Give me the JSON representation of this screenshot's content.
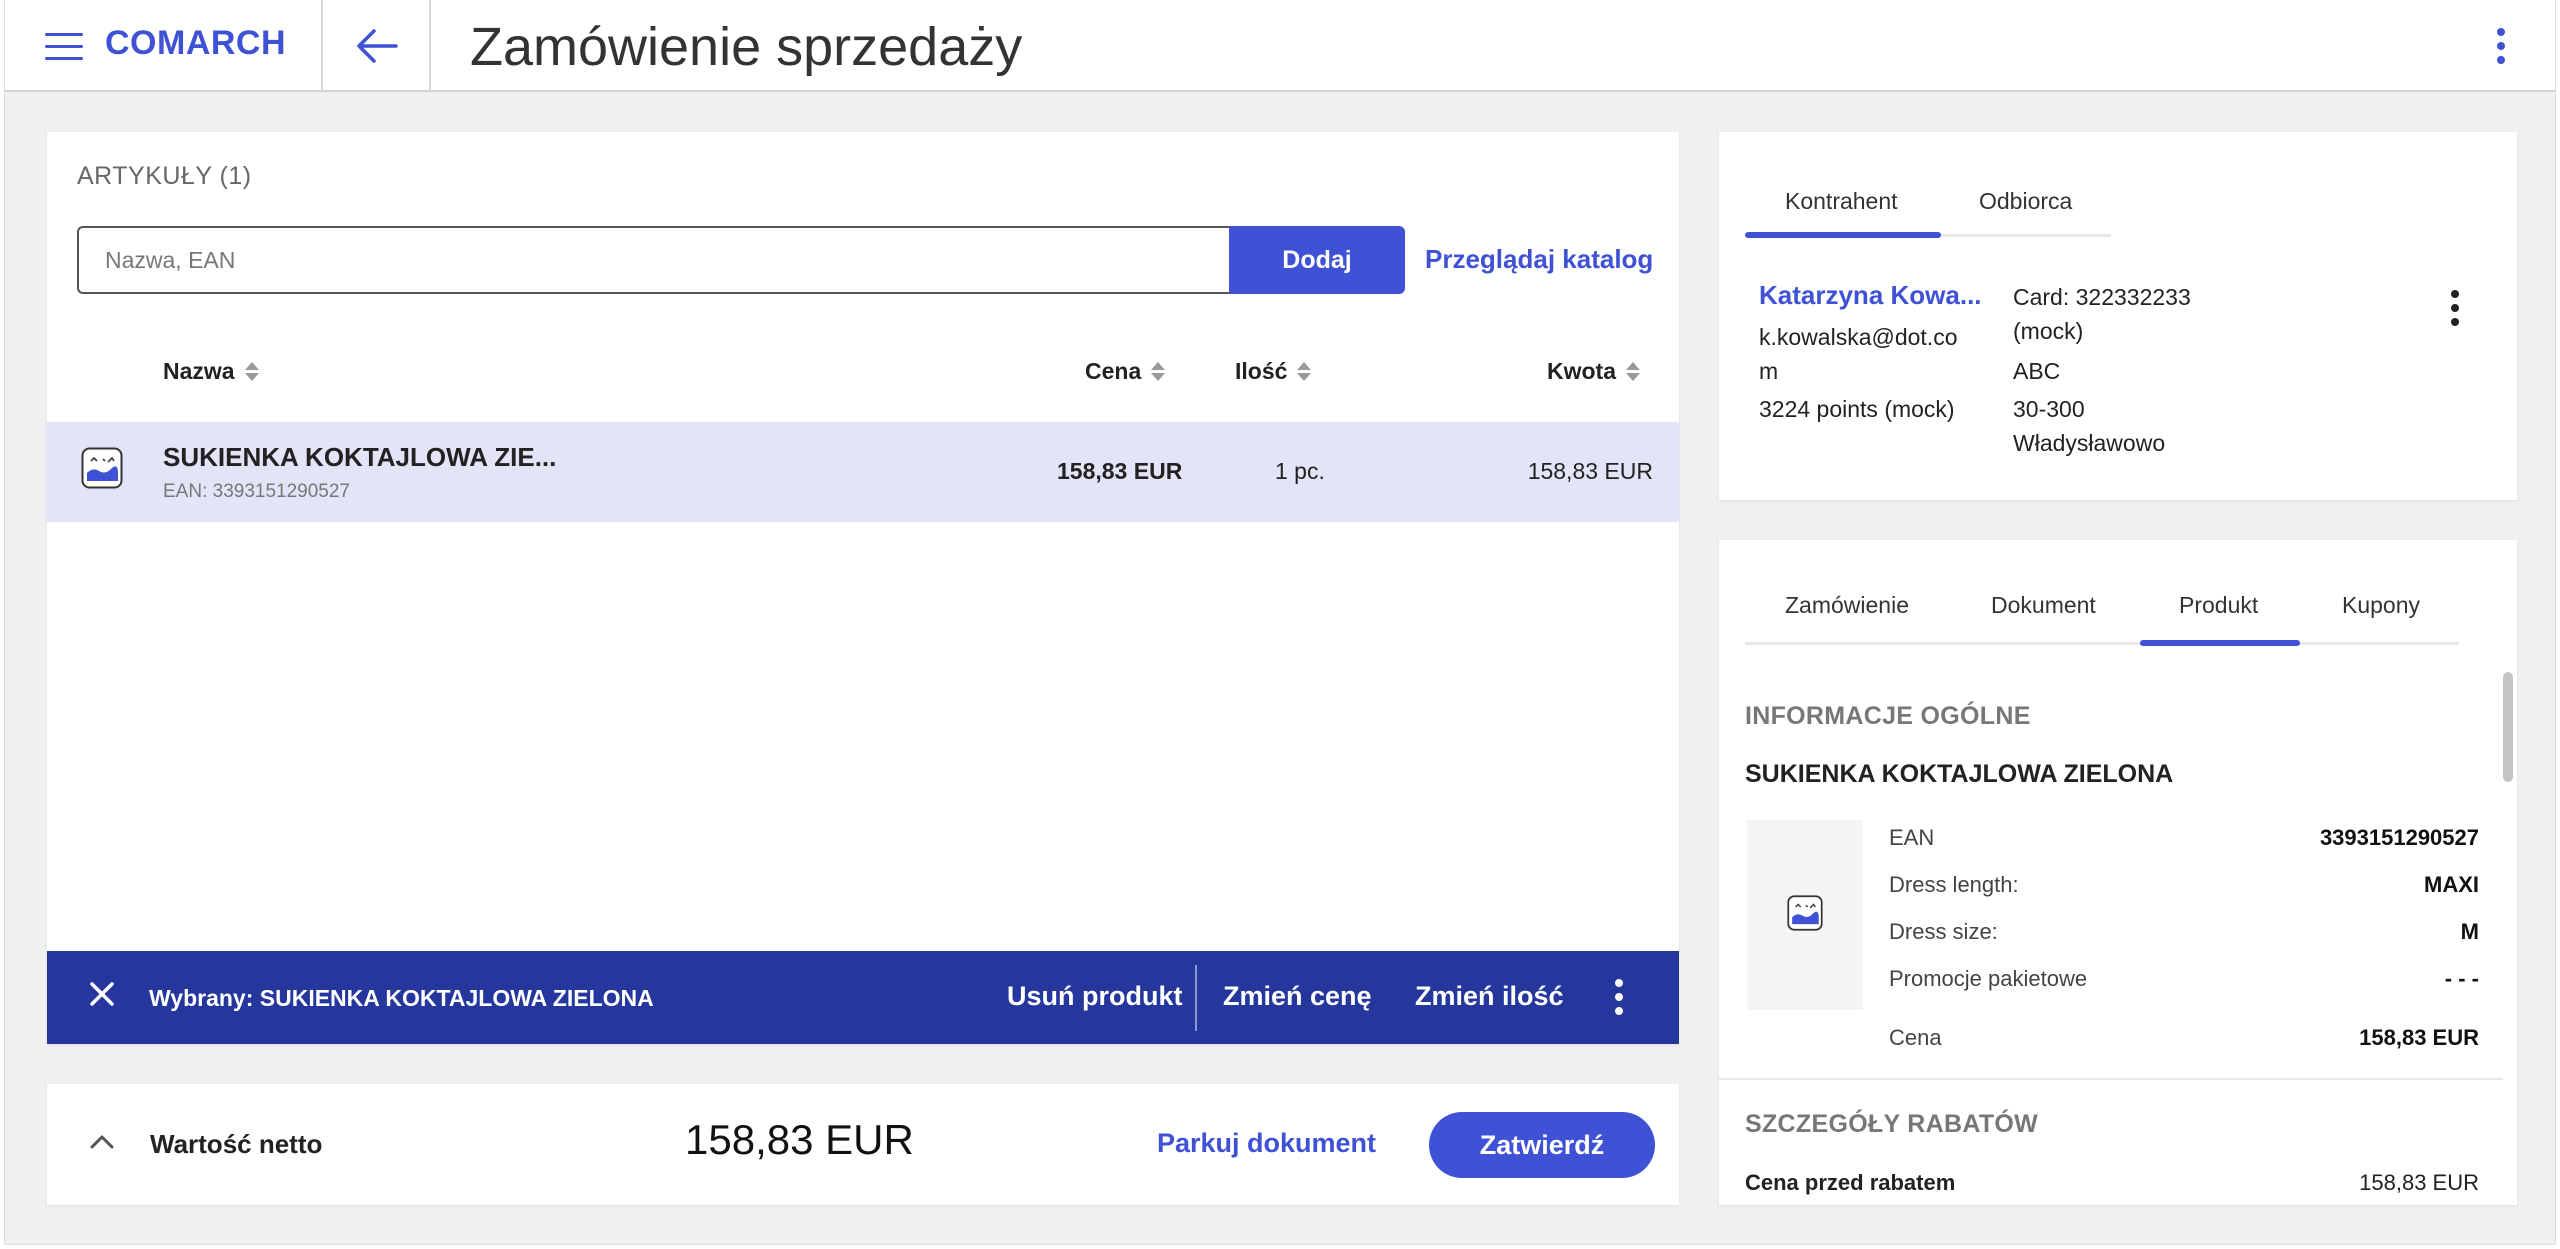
{
  "header": {
    "brand": "COMARCH",
    "title": "Zamówienie sprzedaży"
  },
  "articles": {
    "section_title": "ARTYKUŁY (1)",
    "search_placeholder": "Nazwa, EAN",
    "add_label": "Dodaj",
    "catalog_link": "Przeglądaj katalog",
    "columns": {
      "name": "Nazwa",
      "price": "Cena",
      "qty": "Ilość",
      "amount": "Kwota"
    },
    "rows": [
      {
        "name": "SUKIENKA KOKTAJLOWA ZIE...",
        "ean": "EAN: 3393151290527",
        "price": "158,83 EUR",
        "qty": "1 pc.",
        "amount": "158,83 EUR"
      }
    ]
  },
  "selection_bar": {
    "label": "Wybrany: SUKIENKA KOKTAJLOWA ZIELONA",
    "remove": "Usuń produkt",
    "change_price": "Zmień cenę",
    "change_qty": "Zmień ilość"
  },
  "summary": {
    "net_label": "Wartość netto",
    "net_value": "158,83 EUR",
    "park_label": "Parkuj dokument",
    "confirm_label": "Zatwierdź"
  },
  "customer": {
    "tabs": [
      "Kontrahent",
      "Odbiorca"
    ],
    "active_tab": "Kontrahent",
    "name": "Katarzyna Kowa...",
    "email_line1": "k.kowalska@dot.co",
    "email_line2": "m",
    "points": "3224 points (mock)",
    "card_line1": "Card: 322332233",
    "card_line2": "(mock)",
    "address1": "ABC",
    "address2": "30-300",
    "address3": "Władysławowo"
  },
  "details": {
    "tabs": [
      "Zamówienie",
      "Dokument",
      "Produkt",
      "Kupony"
    ],
    "active_tab": "Produkt",
    "info_title": "INFORMACJE OGÓLNE",
    "product_title": "SUKIENKA KOKTAJLOWA ZIELONA",
    "attributes": [
      {
        "name": "EAN",
        "value": "3393151290527"
      },
      {
        "name": "Dress length:",
        "value": "MAXI"
      },
      {
        "name": "Dress size:",
        "value": "M"
      },
      {
        "name": "Promocje pakietowe",
        "value": "- - -"
      },
      {
        "name": "Cena",
        "value": "158,83 EUR"
      }
    ],
    "discount_title": "SZCZEGÓŁY RABATÓW",
    "discount_rows": [
      {
        "name": "Cena przed rabatem",
        "value": "158,83 EUR"
      }
    ]
  },
  "colors": {
    "accent": "#3f51d5",
    "selection_bar": "#25379d",
    "row_highlight": "#e3e4f7"
  }
}
